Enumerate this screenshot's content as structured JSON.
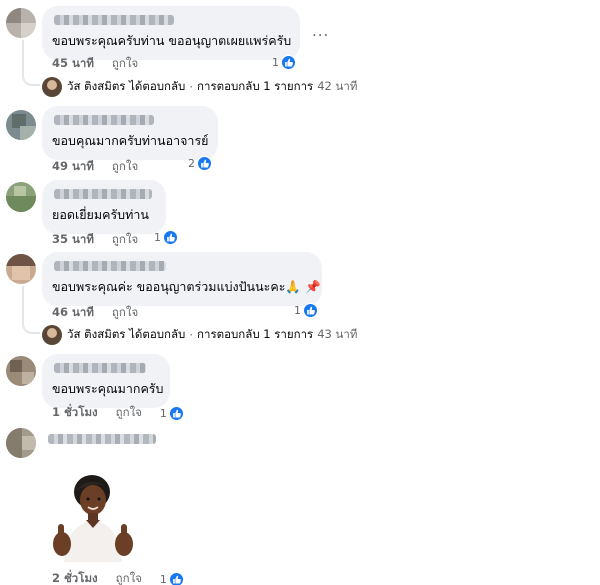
{
  "comments": [
    {
      "text": "ขอบพระคุณครับท่าน ขออนุญาตเผยแพร่ครับ",
      "time": "45 นาที",
      "like_label": "ถูกใจ",
      "reactions": "1",
      "more_label": "...",
      "reply": {
        "name": "วัส ติงสมิตร",
        "action": "ได้ตอบกลับ",
        "sep": "·",
        "count_text": "การตอบกลับ 1 รายการ",
        "time": "42 นาที"
      }
    },
    {
      "text": "ขอบคุณมากครับท่านอาจารย์",
      "time": "49 นาที",
      "like_label": "ถูกใจ",
      "reactions": "2"
    },
    {
      "text": "ยอดเยี่ยมครับท่าน",
      "time": "35 นาที",
      "like_label": "ถูกใจ",
      "reactions": "1"
    },
    {
      "text": "ขอบพระคุณค่ะ ขออนุญาตร่วมแบ่งปันนะคะ🙏 📌",
      "time": "46 นาที",
      "like_label": "ถูกใจ",
      "reactions": "1",
      "reply": {
        "name": "วัส ติงสมิตร",
        "action": "ได้ตอบกลับ",
        "sep": "·",
        "count_text": "การตอบกลับ 1 รายการ",
        "time": "43 นาที"
      }
    },
    {
      "text": "ขอบพระคุณมากครับ",
      "time": "1 ชั่วโมง",
      "like_label": "ถูกใจ",
      "reactions": "1"
    },
    {
      "time": "2 ชั่วโมง",
      "like_label": "ถูกใจ",
      "reactions": "1",
      "sticker": "avatar-thumbs-up-sticker"
    }
  ],
  "colors": {
    "bubble": "#f0f2f5",
    "like_blue": "#1877f2",
    "meta_gray": "#65676b"
  }
}
